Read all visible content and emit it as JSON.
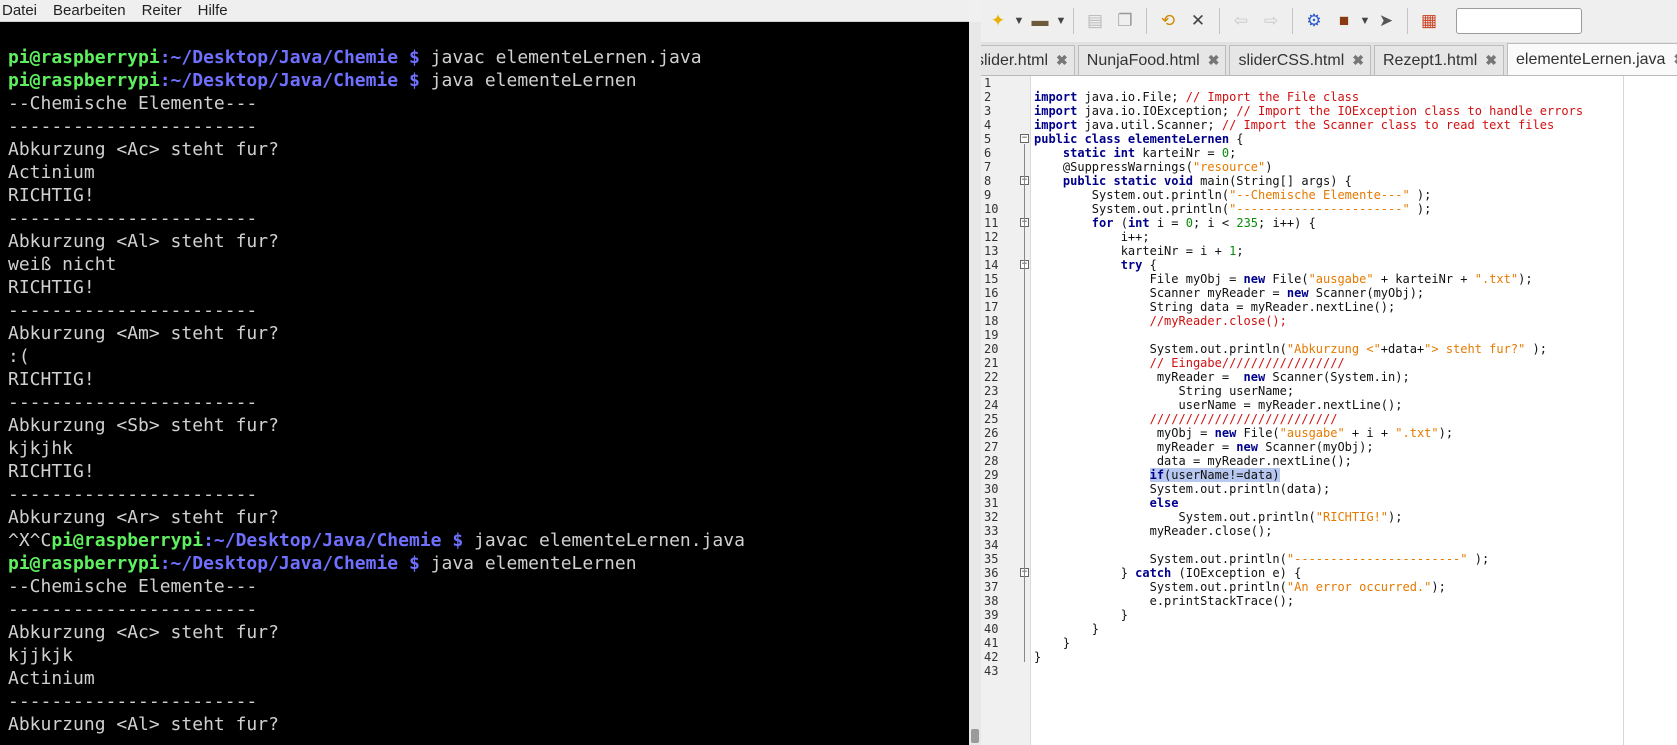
{
  "terminal": {
    "menu": [
      "Datei",
      "Bearbeiten",
      "Reiter",
      "Hilfe"
    ],
    "lines": [
      {
        "type": "prompt",
        "user": "pi@raspberrypi",
        "path": ":~/Desktop/Java/Chemie $",
        "cmd": " javac elementeLernen.java"
      },
      {
        "type": "prompt",
        "user": "pi@raspberrypi",
        "path": ":~/Desktop/Java/Chemie $",
        "cmd": " java elementeLernen"
      },
      {
        "type": "text",
        "text": "--Chemische Elemente---"
      },
      {
        "type": "text",
        "text": "-----------------------"
      },
      {
        "type": "text",
        "text": "Abkurzung <Ac> steht fur?"
      },
      {
        "type": "text",
        "text": "Actinium"
      },
      {
        "type": "text",
        "text": "RICHTIG!"
      },
      {
        "type": "text",
        "text": "-----------------------"
      },
      {
        "type": "text",
        "text": "Abkurzung <Al> steht fur?"
      },
      {
        "type": "text",
        "text": "weiß nicht"
      },
      {
        "type": "text",
        "text": "RICHTIG!"
      },
      {
        "type": "text",
        "text": "-----------------------"
      },
      {
        "type": "text",
        "text": "Abkurzung <Am> steht fur?"
      },
      {
        "type": "text",
        "text": ":("
      },
      {
        "type": "text",
        "text": "RICHTIG!"
      },
      {
        "type": "text",
        "text": "-----------------------"
      },
      {
        "type": "text",
        "text": "Abkurzung <Sb> steht fur?"
      },
      {
        "type": "text",
        "text": "kjkjhk"
      },
      {
        "type": "text",
        "text": "RICHTIG!"
      },
      {
        "type": "text",
        "text": "-----------------------"
      },
      {
        "type": "text",
        "text": "Abkurzung <Ar> steht fur?"
      },
      {
        "type": "prompt",
        "pre": "^X^C",
        "user": "pi@raspberrypi",
        "path": ":~/Desktop/Java/Chemie $",
        "cmd": " javac elementeLernen.java"
      },
      {
        "type": "prompt",
        "user": "pi@raspberrypi",
        "path": ":~/Desktop/Java/Chemie $",
        "cmd": " java elementeLernen"
      },
      {
        "type": "text",
        "text": "--Chemische Elemente---"
      },
      {
        "type": "text",
        "text": "-----------------------"
      },
      {
        "type": "text",
        "text": "Abkurzung <Ac> steht fur?"
      },
      {
        "type": "text",
        "text": "kjjkjk"
      },
      {
        "type": "text",
        "text": "Actinium"
      },
      {
        "type": "text",
        "text": "-----------------------"
      },
      {
        "type": "text",
        "text": "Abkurzung <Al> steht fur?"
      }
    ]
  },
  "editor": {
    "tabs": [
      {
        "label": "slider.html",
        "active": false
      },
      {
        "label": "NunjaFood.html",
        "active": false
      },
      {
        "label": "sliderCSS.html",
        "active": false
      },
      {
        "label": "Rezept1.html",
        "active": false
      },
      {
        "label": "elementeLernen.java",
        "active": true
      }
    ],
    "close_glyph": "✖",
    "toolbar_icons": [
      "new-file-icon",
      "open-folder-icon",
      "save-icon",
      "save-all-icon",
      "reload-icon",
      "close-icon",
      "back-icon",
      "forward-icon",
      "compile-icon",
      "build-icon",
      "run-icon",
      "color-chooser-icon"
    ],
    "line_numbers": [
      "1",
      "2",
      "3",
      "4",
      "5",
      "6",
      "7",
      "8",
      "9",
      "10",
      "11",
      "12",
      "13",
      "14",
      "15",
      "16",
      "17",
      "18",
      "19",
      "20",
      "21",
      "22",
      "23",
      "24",
      "25",
      "26",
      "27",
      "28",
      "29",
      "30",
      "31",
      "32",
      "33",
      "34",
      "35",
      "36",
      "37",
      "38",
      "39",
      "40",
      "41",
      "42",
      "43"
    ],
    "code": [
      [],
      [
        {
          "t": "kw",
          "v": "import"
        },
        {
          "t": "p",
          "v": " java.io.File; "
        },
        {
          "t": "cmt",
          "v": "// Import the File class"
        }
      ],
      [
        {
          "t": "kw",
          "v": "import"
        },
        {
          "t": "p",
          "v": " java.io.IOException; "
        },
        {
          "t": "cmt",
          "v": "// Import the IOException class to handle errors"
        }
      ],
      [
        {
          "t": "kw",
          "v": "import"
        },
        {
          "t": "p",
          "v": " java.util.Scanner; "
        },
        {
          "t": "cmt",
          "v": "// Import the Scanner class to read text files"
        }
      ],
      [
        {
          "t": "kw",
          "v": "public class elementeLernen"
        },
        {
          "t": "p",
          "v": " {"
        }
      ],
      [
        {
          "t": "p",
          "v": "    "
        },
        {
          "t": "kw",
          "v": "static int"
        },
        {
          "t": "p",
          "v": " karteiNr = "
        },
        {
          "t": "num",
          "v": "0"
        },
        {
          "t": "p",
          "v": ";"
        }
      ],
      [
        {
          "t": "p",
          "v": "    @SuppressWarnings("
        },
        {
          "t": "str",
          "v": "\"resource\""
        },
        {
          "t": "p",
          "v": ")"
        }
      ],
      [
        {
          "t": "p",
          "v": "    "
        },
        {
          "t": "kw",
          "v": "public static void"
        },
        {
          "t": "p",
          "v": " main(String[] args) {"
        }
      ],
      [
        {
          "t": "p",
          "v": "        System.out.println("
        },
        {
          "t": "str",
          "v": "\"--Chemische Elemente---\""
        },
        {
          "t": "p",
          "v": " );"
        }
      ],
      [
        {
          "t": "p",
          "v": "        System.out.println("
        },
        {
          "t": "str",
          "v": "\"-----------------------\""
        },
        {
          "t": "p",
          "v": " );"
        }
      ],
      [
        {
          "t": "p",
          "v": "        "
        },
        {
          "t": "kw",
          "v": "for"
        },
        {
          "t": "p",
          "v": " ("
        },
        {
          "t": "kw",
          "v": "int"
        },
        {
          "t": "p",
          "v": " i = "
        },
        {
          "t": "num",
          "v": "0"
        },
        {
          "t": "p",
          "v": "; i < "
        },
        {
          "t": "num",
          "v": "235"
        },
        {
          "t": "p",
          "v": "; i++) {"
        }
      ],
      [
        {
          "t": "p",
          "v": "            i++;"
        }
      ],
      [
        {
          "t": "p",
          "v": "            karteiNr = i + "
        },
        {
          "t": "num",
          "v": "1"
        },
        {
          "t": "p",
          "v": ";"
        }
      ],
      [
        {
          "t": "p",
          "v": "            "
        },
        {
          "t": "kw",
          "v": "try"
        },
        {
          "t": "p",
          "v": " {"
        }
      ],
      [
        {
          "t": "p",
          "v": "                File myObj = "
        },
        {
          "t": "kw",
          "v": "new"
        },
        {
          "t": "p",
          "v": " File("
        },
        {
          "t": "str",
          "v": "\"ausgabe\""
        },
        {
          "t": "p",
          "v": " + karteiNr + "
        },
        {
          "t": "str",
          "v": "\".txt\""
        },
        {
          "t": "p",
          "v": ");"
        }
      ],
      [
        {
          "t": "p",
          "v": "                Scanner myReader = "
        },
        {
          "t": "kw",
          "v": "new"
        },
        {
          "t": "p",
          "v": " Scanner(myObj);"
        }
      ],
      [
        {
          "t": "p",
          "v": "                String data = myReader.nextLine();"
        }
      ],
      [
        {
          "t": "p",
          "v": "                "
        },
        {
          "t": "cmt",
          "v": "//myReader.close();"
        }
      ],
      [],
      [
        {
          "t": "p",
          "v": "                System.out.println("
        },
        {
          "t": "str",
          "v": "\"Abkurzung <\""
        },
        {
          "t": "p",
          "v": "+data+"
        },
        {
          "t": "str",
          "v": "\"> steht fur?\""
        },
        {
          "t": "p",
          "v": " );"
        }
      ],
      [
        {
          "t": "p",
          "v": "                "
        },
        {
          "t": "cmt",
          "v": "// Eingabe/////////////////"
        }
      ],
      [
        {
          "t": "p",
          "v": "                 myReader =  "
        },
        {
          "t": "kw",
          "v": "new"
        },
        {
          "t": "p",
          "v": " Scanner(System.in);"
        }
      ],
      [
        {
          "t": "p",
          "v": "                    String userName;"
        }
      ],
      [
        {
          "t": "p",
          "v": "                    userName = myReader.nextLine();"
        }
      ],
      [
        {
          "t": "p",
          "v": "                "
        },
        {
          "t": "cmt",
          "v": "//////////////////////////"
        }
      ],
      [
        {
          "t": "p",
          "v": "                 myObj = "
        },
        {
          "t": "kw",
          "v": "new"
        },
        {
          "t": "p",
          "v": " File("
        },
        {
          "t": "str",
          "v": "\"ausgabe\""
        },
        {
          "t": "p",
          "v": " + i + "
        },
        {
          "t": "str",
          "v": "\".txt\""
        },
        {
          "t": "p",
          "v": ");"
        }
      ],
      [
        {
          "t": "p",
          "v": "                 myReader = "
        },
        {
          "t": "kw",
          "v": "new"
        },
        {
          "t": "p",
          "v": " Scanner(myObj);"
        }
      ],
      [
        {
          "t": "p",
          "v": "                 data = myReader.nextLine();"
        }
      ],
      [
        {
          "t": "p",
          "v": "                "
        },
        {
          "t": "hlkw",
          "v": "if"
        },
        {
          "t": "hl",
          "v": "(userName!=data)"
        }
      ],
      [
        {
          "t": "p",
          "v": "                System.out.println(data);"
        }
      ],
      [
        {
          "t": "p",
          "v": "                "
        },
        {
          "t": "kw",
          "v": "else"
        }
      ],
      [
        {
          "t": "p",
          "v": "                    System.out.println("
        },
        {
          "t": "str",
          "v": "\"RICHTIG!\""
        },
        {
          "t": "p",
          "v": ");"
        }
      ],
      [
        {
          "t": "p",
          "v": "                myReader.close();"
        }
      ],
      [],
      [
        {
          "t": "p",
          "v": "                System.out.println("
        },
        {
          "t": "str",
          "v": "\"-----------------------\""
        },
        {
          "t": "p",
          "v": " );"
        }
      ],
      [
        {
          "t": "p",
          "v": "            } "
        },
        {
          "t": "kw",
          "v": "catch"
        },
        {
          "t": "p",
          "v": " (IOException e) {"
        }
      ],
      [
        {
          "t": "p",
          "v": "                System.out.println("
        },
        {
          "t": "str",
          "v": "\"An error occurred.\""
        },
        {
          "t": "p",
          "v": ");"
        }
      ],
      [
        {
          "t": "p",
          "v": "                e.printStackTrace();"
        }
      ],
      [
        {
          "t": "p",
          "v": "            }"
        }
      ],
      [
        {
          "t": "p",
          "v": "        }"
        }
      ],
      [
        {
          "t": "p",
          "v": "    }"
        }
      ],
      [
        {
          "t": "p",
          "v": "}"
        }
      ],
      []
    ]
  }
}
